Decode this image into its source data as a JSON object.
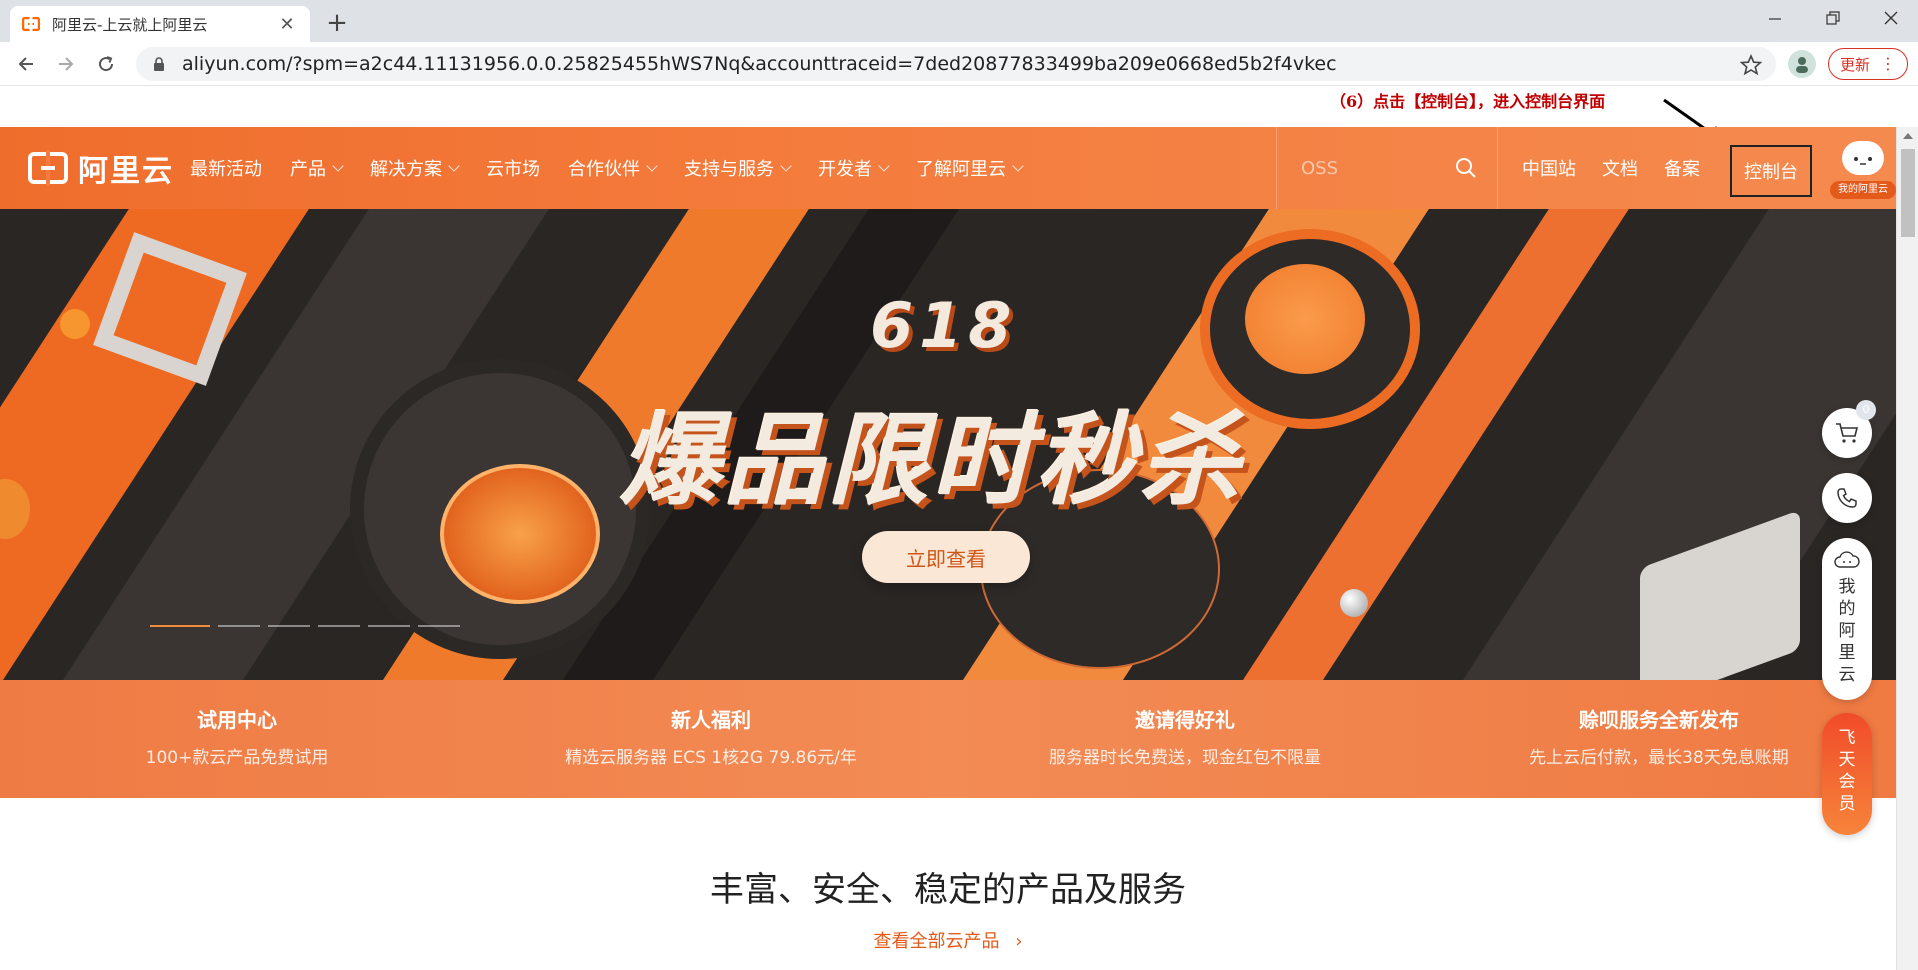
{
  "browser": {
    "tab_title": "阿里云-上云就上阿里云",
    "url": "aliyun.com/?spm=a2c44.11131956.0.0.25825455hWS7Nq&accounttraceid=7ded20877833499ba209e0668ed5b2f4vkec",
    "update_label": "更新"
  },
  "annotation": {
    "text": "（6）点击【控制台】，进入控制台界面",
    "color": "#c00000"
  },
  "header": {
    "logo_text": "阿里云",
    "nav": [
      {
        "label": "最新活动"
      },
      {
        "label": "产品"
      },
      {
        "label": "解决方案"
      },
      {
        "label": "云市场"
      },
      {
        "label": "合作伙伴"
      },
      {
        "label": "支持与服务"
      },
      {
        "label": "开发者"
      },
      {
        "label": "了解阿里云"
      }
    ],
    "search_placeholder": "OSS",
    "right_nav": [
      {
        "label": "中国站"
      },
      {
        "label": "文档"
      },
      {
        "label": "备案"
      }
    ],
    "console_label": "控制台",
    "avatar_tag": "我的阿里云"
  },
  "banner": {
    "event": "618",
    "headline": "爆品限时秒杀",
    "cta": "立即查看",
    "slide_count": 6,
    "active_slide": 1
  },
  "features": [
    {
      "title": "试用中心",
      "subtitle": "100+款云产品免费试用"
    },
    {
      "title": "新人福利",
      "subtitle": "精选云服务器 ECS 1核2G 79.86元/年"
    },
    {
      "title": "邀请得好礼",
      "subtitle": "服务器时长免费送，现金红包不限量"
    },
    {
      "title": "赊呗服务全新发布",
      "subtitle": "先上云后付款，最长38天免息账期"
    }
  ],
  "section": {
    "title": "丰富、安全、稳定的产品及服务",
    "link": "查看全部云产品"
  },
  "side_toolbar": {
    "cart_count": "0",
    "mine_label": "我的阿里云",
    "vip_label": "飞天会员"
  },
  "colors": {
    "brand_orange": "#f47b3c",
    "accent": "#e35a1b"
  }
}
